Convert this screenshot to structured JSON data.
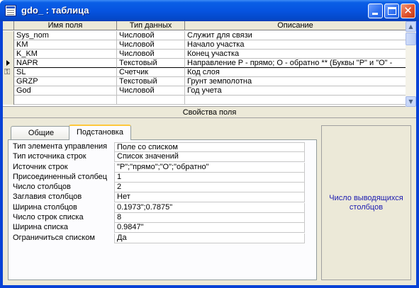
{
  "window": {
    "title": "gdo_ : таблица",
    "buttons": {
      "minimize": "minimize",
      "maximize": "maximize",
      "close": "close"
    }
  },
  "grid": {
    "headers": {
      "name": "Имя поля",
      "type": "Тип данных",
      "desc": "Описание"
    },
    "rows": [
      {
        "name": "Sys_nom",
        "type": "Числовой",
        "desc": "Служит для связи",
        "marker": ""
      },
      {
        "name": "KM",
        "type": "Числовой",
        "desc": "Начало участка",
        "marker": ""
      },
      {
        "name": "K_KM",
        "type": "Числовой",
        "desc": "Конец участка",
        "marker": ""
      },
      {
        "name": "NAPR",
        "type": "Текстовый",
        "desc": "Направление    P - прямо; O - обратно **  (Буквы \"P\" и \"O\" -",
        "marker": "current-row-arrow"
      },
      {
        "name": "SL",
        "type": "Счетчик",
        "desc": "Код слоя",
        "marker": "primary-key-icon"
      },
      {
        "name": "GRZP",
        "type": "Текстовый",
        "desc": "Грунт земполотна",
        "marker": ""
      },
      {
        "name": "God",
        "type": "Числовой",
        "desc": "Год учета",
        "marker": ""
      },
      {
        "name": "",
        "type": "",
        "desc": "",
        "marker": ""
      }
    ]
  },
  "properties": {
    "title": "Свойства поля",
    "tabs": {
      "general": "Общие",
      "lookup": "Подстановка"
    },
    "active_tab": "lookup",
    "rows": [
      {
        "label": "Тип элемента управления",
        "value": "Поле со списком"
      },
      {
        "label": "Тип источника строк",
        "value": "Список значений"
      },
      {
        "label": "Источник строк",
        "value": "\"P\";\"прямо\";\"O\";\"обратно\""
      },
      {
        "label": "Присоединенный столбец",
        "value": "1"
      },
      {
        "label": "Число столбцов",
        "value": "2"
      },
      {
        "label": "Заглавия столбцов",
        "value": "Нет"
      },
      {
        "label": "Ширина столбцов",
        "value": "0.1973\";0.7875\""
      },
      {
        "label": "Число строк списка",
        "value": "8"
      },
      {
        "label": "Ширина списка",
        "value": "0.9847\""
      },
      {
        "label": "Ограничиться списком",
        "value": "Да"
      }
    ],
    "help_text": "Число выводящихся столбцов"
  },
  "colors": {
    "titlebar": "#0654e0",
    "help_text": "#1a1ab0",
    "active_tab_accent": "#ffc83c"
  }
}
